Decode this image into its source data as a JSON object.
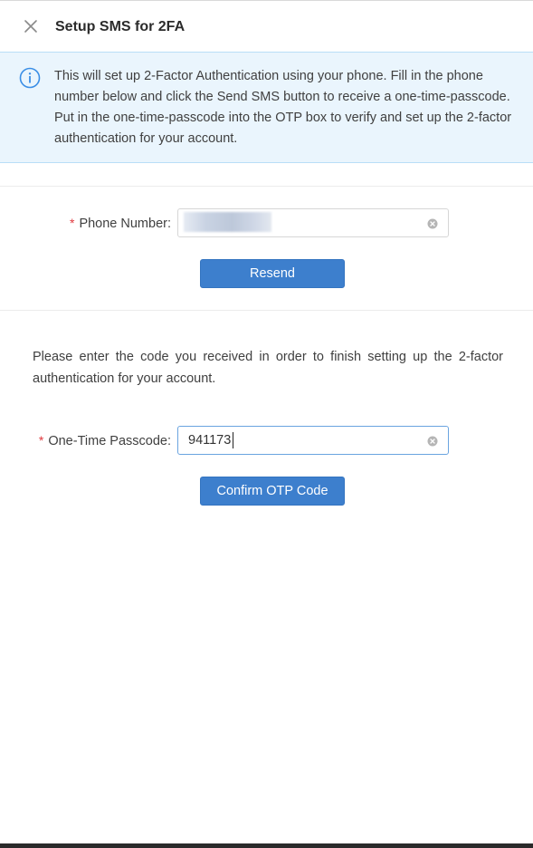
{
  "header": {
    "title": "Setup SMS for 2FA",
    "close_icon": "close-icon"
  },
  "info": {
    "icon": "info-icon",
    "text": "This will set up 2-Factor Authentication using your phone. Fill in the phone number below and click the Send SMS button to receive a one-time-passcode. Put in the one-time-passcode into the OTP box to verify and set up the 2-factor authentication for your account."
  },
  "phone": {
    "required_mark": "*",
    "label": "Phone Number:",
    "value": "",
    "clear_icon": "clear-circle-icon"
  },
  "resend_button": {
    "label": "Resend"
  },
  "otp_section": {
    "instructions": "Please enter the code you received in order to finish setting up the 2-factor authentication for your account.",
    "required_mark": "*",
    "label": "One-Time Passcode:",
    "value": "941173",
    "clear_icon": "clear-circle-icon"
  },
  "confirm_button": {
    "label": "Confirm OTP Code"
  },
  "colors": {
    "primary": "#3d7fcd",
    "info_background": "#eaf5fd",
    "info_border": "#b9def7",
    "info_icon": "#3a8ee6",
    "required": "#e0393e"
  }
}
